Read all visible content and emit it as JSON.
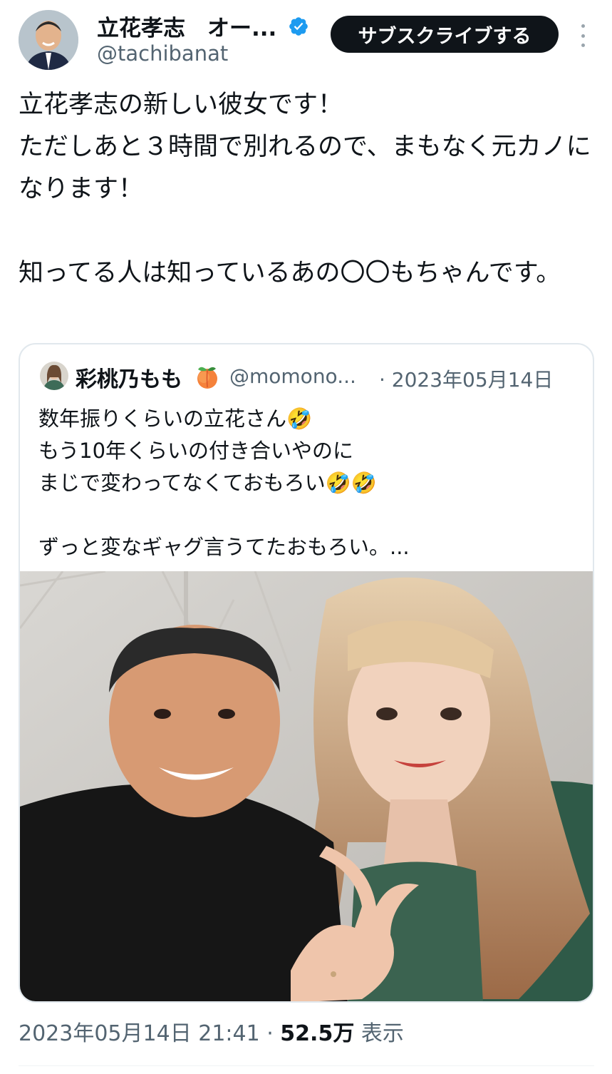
{
  "tweet": {
    "author_name": "立花孝志　オー...",
    "handle": "@tachibanat",
    "verified": true,
    "subscribe_label": "サブスクライブする",
    "text": "立花孝志の新しい彼女です！\nただしあと３時間で別れるので、まもなく元カノになります！\n\n知ってる人は知っているあの〇〇もちゃんです。",
    "timestamp": "2023年05月14日 21:41",
    "separator": " · ",
    "views_count": "52.5万",
    "views_label": " 表示"
  },
  "quote": {
    "author_name": "彩桃乃もも",
    "emoji_icon": "peach-icon",
    "handle": "@momono...",
    "date": "· 2023年05月14日",
    "text": "数年振りくらいの立花さん🤣\nもう10年くらいの付き合いやのに\nまじで変わってなくておもろい🤣🤣\n\nずっと変なギャグ言うてたおもろい。..."
  },
  "colors": {
    "primary_text": "#0f1419",
    "secondary_text": "#536471",
    "verified_blue": "#1d9bf0",
    "button_bg": "#0f1419",
    "border": "#e1e8ed"
  }
}
